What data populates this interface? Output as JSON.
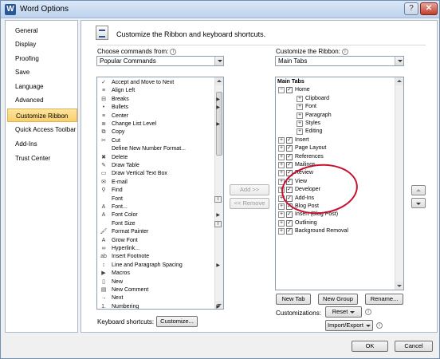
{
  "window": {
    "title": "Word Options",
    "help_icon": "help-icon",
    "close_icon": "close-icon"
  },
  "sidebar": {
    "items": [
      {
        "label": "General",
        "selected": false
      },
      {
        "label": "Display",
        "selected": false
      },
      {
        "label": "Proofing",
        "selected": false
      },
      {
        "label": "Save",
        "selected": false
      },
      {
        "label": "Language",
        "selected": false
      },
      {
        "label": "Advanced",
        "selected": false
      },
      {
        "label": "Customize Ribbon",
        "selected": true
      },
      {
        "label": "Quick Access Toolbar",
        "selected": false
      },
      {
        "label": "Add-Ins",
        "selected": false
      },
      {
        "label": "Trust Center",
        "selected": false
      }
    ]
  },
  "header": {
    "title": "Customize the Ribbon and keyboard shortcuts."
  },
  "left": {
    "choose_label": "Choose commands from:",
    "choose_value": "Popular Commands",
    "commands": [
      {
        "label": "Accept and Move to Next",
        "icon": "accept-icon",
        "glyph": "✓",
        "submenu": false,
        "fieldbox": false
      },
      {
        "label": "Align Left",
        "icon": "align-left-icon",
        "glyph": "≡",
        "submenu": false,
        "fieldbox": false
      },
      {
        "label": "Breaks",
        "icon": "breaks-icon",
        "glyph": "⊟",
        "submenu": true,
        "fieldbox": false
      },
      {
        "label": "Bullets",
        "icon": "bullets-icon",
        "glyph": "•",
        "submenu": true,
        "fieldbox": false
      },
      {
        "label": "Center",
        "icon": "align-center-icon",
        "glyph": "≡",
        "submenu": false,
        "fieldbox": false
      },
      {
        "label": "Change List Level",
        "icon": "list-level-icon",
        "glyph": "≣",
        "submenu": true,
        "fieldbox": false
      },
      {
        "label": "Copy",
        "icon": "copy-icon",
        "glyph": "⧉",
        "submenu": false,
        "fieldbox": false
      },
      {
        "label": "Cut",
        "icon": "cut-icon",
        "glyph": "✂",
        "submenu": false,
        "fieldbox": false
      },
      {
        "label": "Define New Number Format...",
        "icon": "",
        "glyph": "",
        "submenu": false,
        "fieldbox": false
      },
      {
        "label": "Delete",
        "icon": "delete-icon",
        "glyph": "✖",
        "submenu": false,
        "fieldbox": false
      },
      {
        "label": "Draw Table",
        "icon": "draw-table-icon",
        "glyph": "✎",
        "submenu": false,
        "fieldbox": false
      },
      {
        "label": "Draw Vertical Text Box",
        "icon": "text-box-icon",
        "glyph": "▭",
        "submenu": false,
        "fieldbox": false
      },
      {
        "label": "E-mail",
        "icon": "email-icon",
        "glyph": "✉",
        "submenu": false,
        "fieldbox": false
      },
      {
        "label": "Find",
        "icon": "find-icon",
        "glyph": "⚲",
        "submenu": false,
        "fieldbox": false
      },
      {
        "label": "Font",
        "icon": "",
        "glyph": "",
        "submenu": false,
        "fieldbox": true
      },
      {
        "label": "Font...",
        "icon": "font-icon",
        "glyph": "A",
        "submenu": false,
        "fieldbox": false
      },
      {
        "label": "Font Color",
        "icon": "font-color-icon",
        "glyph": "A",
        "submenu": true,
        "fieldbox": false
      },
      {
        "label": "Font Size",
        "icon": "",
        "glyph": "",
        "submenu": false,
        "fieldbox": true
      },
      {
        "label": "Format Painter",
        "icon": "format-painter-icon",
        "glyph": "🖌",
        "submenu": false,
        "fieldbox": false
      },
      {
        "label": "Grow Font",
        "icon": "grow-font-icon",
        "glyph": "A",
        "submenu": false,
        "fieldbox": false
      },
      {
        "label": "Hyperlink...",
        "icon": "hyperlink-icon",
        "glyph": "∞",
        "submenu": false,
        "fieldbox": false
      },
      {
        "label": "Insert Footnote",
        "icon": "footnote-icon",
        "glyph": "ab",
        "submenu": false,
        "fieldbox": false
      },
      {
        "label": "Line and Paragraph Spacing",
        "icon": "line-spacing-icon",
        "glyph": "↕",
        "submenu": true,
        "fieldbox": false
      },
      {
        "label": "Macros",
        "icon": "macros-icon",
        "glyph": "▶",
        "submenu": false,
        "fieldbox": false
      },
      {
        "label": "New",
        "icon": "new-document-icon",
        "glyph": "▯",
        "submenu": false,
        "fieldbox": false
      },
      {
        "label": "New Comment",
        "icon": "new-comment-icon",
        "glyph": "▤",
        "submenu": false,
        "fieldbox": false
      },
      {
        "label": "Next",
        "icon": "next-icon",
        "glyph": "→",
        "submenu": false,
        "fieldbox": false
      },
      {
        "label": "Numbering",
        "icon": "numbering-icon",
        "glyph": "1.",
        "submenu": true,
        "fieldbox": false
      }
    ],
    "keyboard_label": "Keyboard shortcuts:",
    "customize_button": "Customize..."
  },
  "middle": {
    "add_button": "Add >>",
    "remove_button": "<< Remove"
  },
  "right": {
    "customize_label": "Customize the Ribbon:",
    "customize_value": "Main Tabs",
    "tree": [
      {
        "label": "Main Tabs",
        "level": 0,
        "expand": "",
        "checked": null,
        "bold": true
      },
      {
        "label": "Home",
        "level": 1,
        "expand": "−",
        "checked": true,
        "bold": false
      },
      {
        "label": "Clipboard",
        "level": 2,
        "expand": "+",
        "checked": null,
        "bold": false
      },
      {
        "label": "Font",
        "level": 2,
        "expand": "+",
        "checked": null,
        "bold": false
      },
      {
        "label": "Paragraph",
        "level": 2,
        "expand": "+",
        "checked": null,
        "bold": false
      },
      {
        "label": "Styles",
        "level": 2,
        "expand": "+",
        "checked": null,
        "bold": false
      },
      {
        "label": "Editing",
        "level": 2,
        "expand": "+",
        "checked": null,
        "bold": false
      },
      {
        "label": "Insert",
        "level": 1,
        "expand": "+",
        "checked": true,
        "bold": false
      },
      {
        "label": "Page Layout",
        "level": 1,
        "expand": "+",
        "checked": true,
        "bold": false
      },
      {
        "label": "References",
        "level": 1,
        "expand": "+",
        "checked": true,
        "bold": false
      },
      {
        "label": "Mailings",
        "level": 1,
        "expand": "+",
        "checked": true,
        "bold": false
      },
      {
        "label": "Review",
        "level": 1,
        "expand": "+",
        "checked": true,
        "bold": false
      },
      {
        "label": "View",
        "level": 1,
        "expand": "+",
        "checked": true,
        "bold": false
      },
      {
        "label": "Developer",
        "level": 1,
        "expand": "+",
        "checked": true,
        "bold": false
      },
      {
        "label": "Add-Ins",
        "level": 1,
        "expand": "+",
        "checked": true,
        "bold": false
      },
      {
        "label": "Blog Post",
        "level": 1,
        "expand": "+",
        "checked": true,
        "bold": false
      },
      {
        "label": "Insert (Blog Post)",
        "level": 1,
        "expand": "+",
        "checked": true,
        "bold": false
      },
      {
        "label": "Outlining",
        "level": 1,
        "expand": "+",
        "checked": true,
        "bold": false
      },
      {
        "label": "Background Removal",
        "level": 1,
        "expand": "+",
        "checked": true,
        "bold": false
      }
    ],
    "new_tab_button": "New Tab",
    "new_group_button": "New Group",
    "rename_button": "Rename...",
    "customizations_label": "Customizations:",
    "reset_button": "Reset",
    "import_export_button": "Import/Export"
  },
  "footer": {
    "ok_button": "OK",
    "cancel_button": "Cancel"
  },
  "colors": {
    "selected_nav": "#f8cf6e",
    "annotation_circle": "#c8102e",
    "title_bar": "#bcd3ee"
  }
}
